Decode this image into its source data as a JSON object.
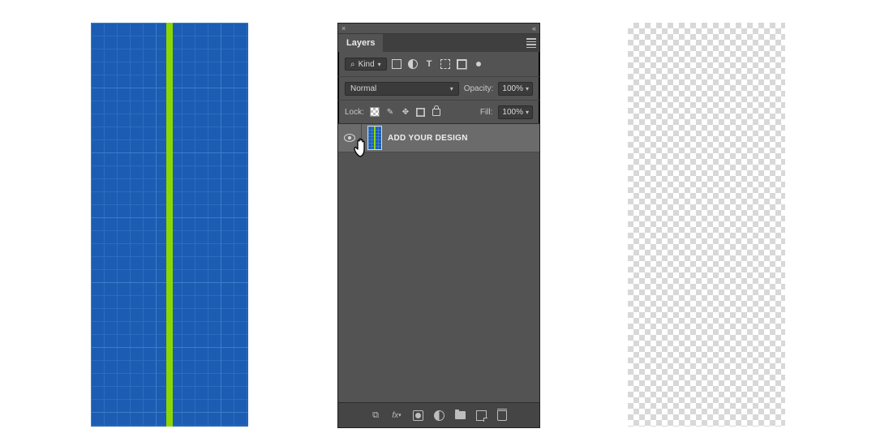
{
  "panel": {
    "close_glyph": "×",
    "collapse_glyph": "«",
    "tab_label": "Layers",
    "filter": {
      "search_glyph": "⌕",
      "kind_label": "Kind"
    },
    "blend": {
      "mode": "Normal",
      "opacity_label": "Opacity:",
      "opacity_value": "100%"
    },
    "lock": {
      "label": "Lock:",
      "fill_label": "Fill:",
      "fill_value": "100%"
    },
    "layer": {
      "name": "ADD YOUR DESIGN"
    },
    "footer": {
      "link_glyph": "⌘",
      "fx_label": "fx"
    }
  }
}
